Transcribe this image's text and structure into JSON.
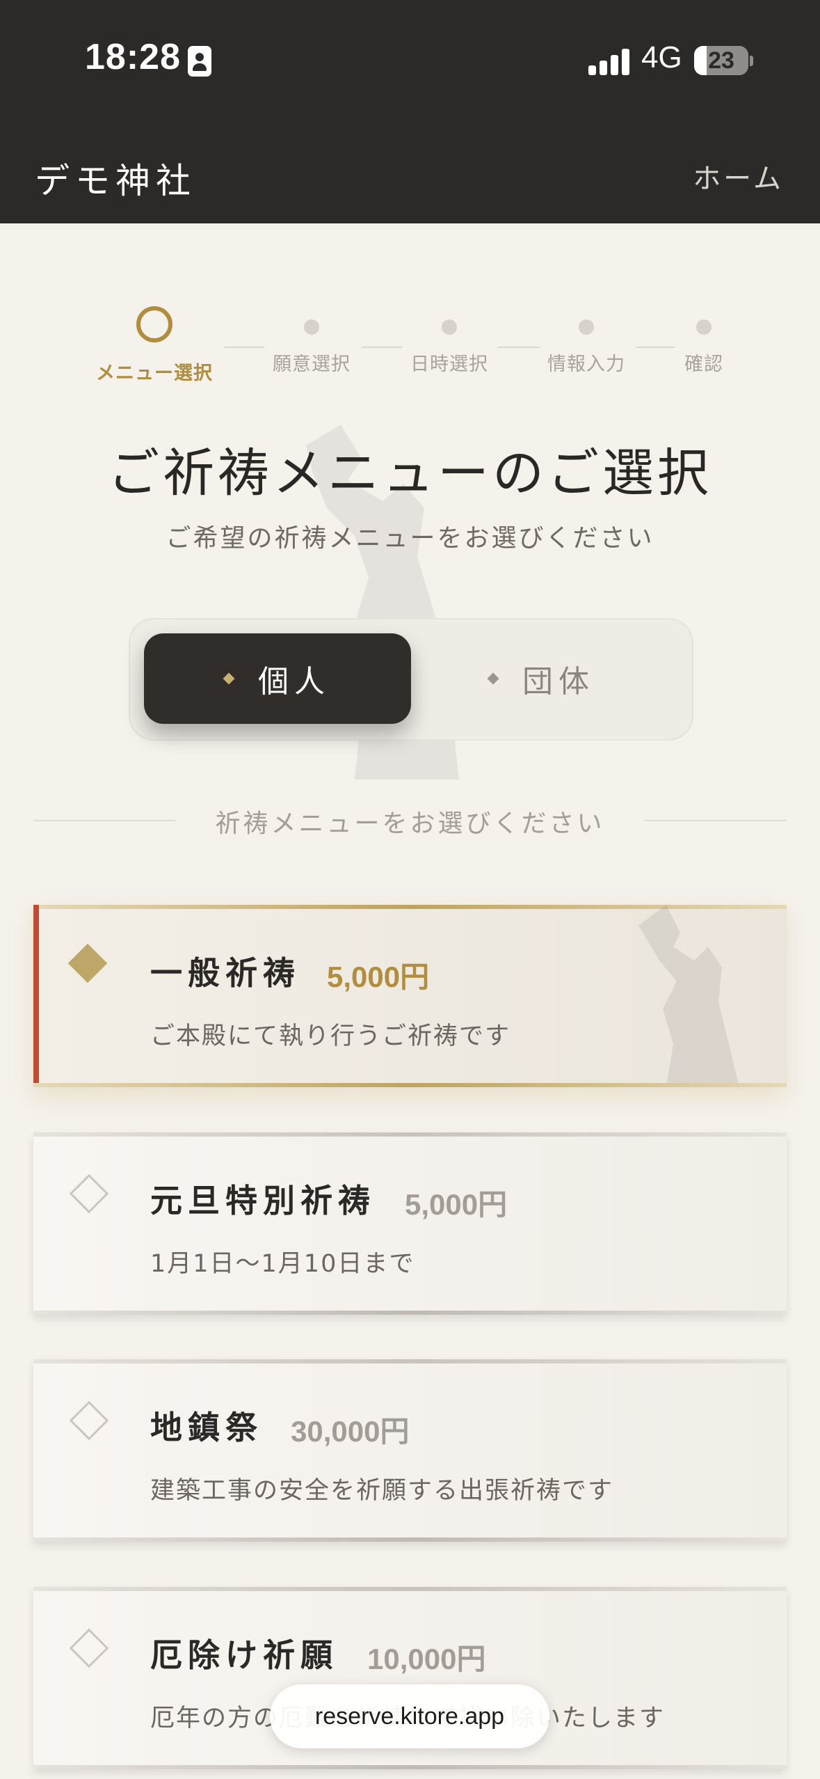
{
  "status_bar": {
    "time": "18:28",
    "network": "4G",
    "battery": "23",
    "battery_level": 0.23
  },
  "header": {
    "shrine_name": "デモ神社",
    "home_link": "ホーム"
  },
  "stepper": {
    "steps": [
      {
        "label": "メニュー選択",
        "active": true
      },
      {
        "label": "願意選択",
        "active": false
      },
      {
        "label": "日時選択",
        "active": false
      },
      {
        "label": "情報入力",
        "active": false
      },
      {
        "label": "確認",
        "active": false
      }
    ]
  },
  "title": "ご祈祷メニューのご選択",
  "subtitle": "ご希望の祈祷メニューをお選びください",
  "toggle": {
    "options": [
      {
        "label": "個人",
        "selected": true
      },
      {
        "label": "団体",
        "selected": false
      }
    ]
  },
  "section_label": "祈祷メニューをお選びください",
  "menus": [
    {
      "title": "一般祈祷",
      "price": "5,000円",
      "description": "ご本殿にて執り行うご祈祷です",
      "selected": true
    },
    {
      "title": "元旦特別祈祷",
      "price": "5,000円",
      "description": "1月1日〜1月10日まで",
      "selected": false
    },
    {
      "title": "地鎮祭",
      "price": "30,000円",
      "description": "建築工事の安全を祈願する出張祈祷です",
      "selected": false
    },
    {
      "title": "厄除け祈願",
      "price": "10,000円",
      "description": "厄年の方の厄難を祈祷にて祓い除いたします",
      "selected": false
    }
  ],
  "url_bar": "reserve.kitore.app",
  "colors": {
    "header_bg": "#2c2a29",
    "accent_gold": "#b08d3f",
    "selected_stripe": "#c04a32",
    "page_bg": "#f5f2ec"
  }
}
